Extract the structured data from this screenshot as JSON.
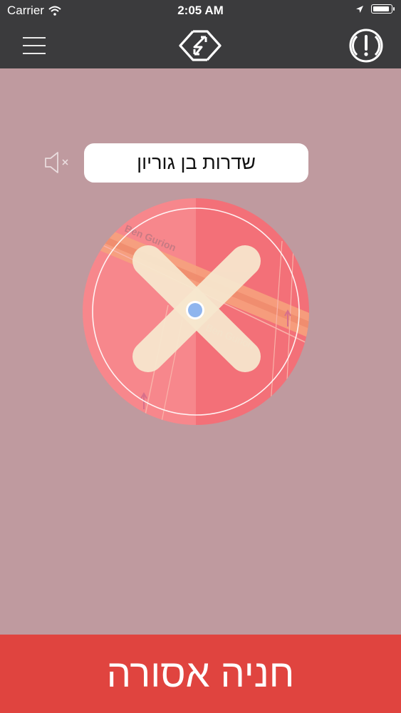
{
  "status_bar": {
    "carrier": "Carrier",
    "time": "2:05 AM"
  },
  "nav": {
    "menu_icon": "hamburger-menu-icon",
    "center_icon": "swap-arrows-icon",
    "right_icon": "alert-icon"
  },
  "street": {
    "name": "שדרות בן גוריון"
  },
  "map": {
    "road_label_1": "Ben Gurion",
    "road_label_2": "Ben Gurion"
  },
  "banner": {
    "text": "חניה אסורה"
  },
  "colors": {
    "background": "#bf9a9f",
    "bar": "#3b3b3d",
    "banner": "#e0443f",
    "circle": "#f4797f"
  }
}
